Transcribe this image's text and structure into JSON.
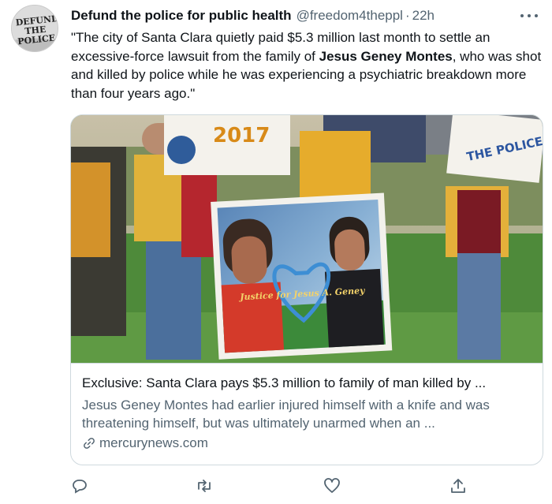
{
  "tweet": {
    "avatar_text": "DEFUND THE POLICE",
    "author_name": "Defund the police for public health",
    "handle": "@freedom4theppl",
    "separator": "·",
    "time": "22h",
    "text_before": "\"The city of Santa Clara quietly paid $5.3 million last month to settle an excessive-force lawsuit from the family of ",
    "text_bold": "Jesus Geney Montes",
    "text_after": ", who was shot and killed by police while he was experiencing a psychiatric breakdown more than four years ago.\""
  },
  "card": {
    "image_sign_left": "2017",
    "image_sign_right": "THE POLICE",
    "image_banner": "Justice for Jesus A. Geney",
    "title": "Exclusive: Santa Clara pays $5.3 million to family of man killed by ...",
    "description": "Jesus Geney Montes had earlier injured himself with a knife and was threatening himself, but was ultimately unarmed when an ...",
    "domain": "mercurynews.com"
  },
  "icons": {
    "reply": "reply-icon",
    "retweet": "retweet-icon",
    "like": "like-icon",
    "share": "share-icon",
    "more": "more-icon",
    "link": "link-icon"
  },
  "colors": {
    "text_primary": "#0f1419",
    "text_secondary": "#536471",
    "border": "#cfd9de"
  }
}
